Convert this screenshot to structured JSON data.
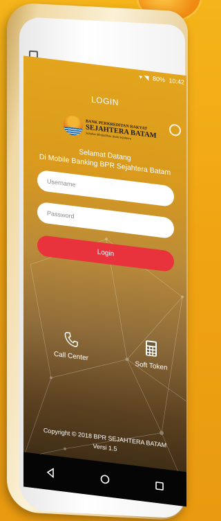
{
  "background": {
    "accent": "#f0a413"
  },
  "status_bar": {
    "battery": "80%",
    "time": "10:42"
  },
  "screen": {
    "title": "LOGIN",
    "logo": {
      "line1": "BANK PERKREDITAN RAKYAT",
      "line2": "SEJAHTERA BATAM",
      "tagline": "Sahabat Menjadikan Anda Sejahtera"
    },
    "welcome_line1": "Selamat Datang",
    "welcome_line2": "Di Mobile Banking BPR Sejahtera Batam",
    "username_placeholder": "Username",
    "password_placeholder": "Password",
    "login_label": "Login",
    "call_center_label": "Call Center",
    "soft_token_label": "Soft Token",
    "copyright": "Copyright © 2018 BPR SEJAHTERA BATAM",
    "version": "Versi 1.5"
  },
  "colors": {
    "login_button": "#e8323c",
    "screen_top": "#e3a51d",
    "navbar": "#050505"
  },
  "icons": [
    "back-icon",
    "settings-gear-icon",
    "phone-icon",
    "calculator-icon",
    "nav-back-icon",
    "nav-home-icon",
    "nav-recent-icon"
  ]
}
